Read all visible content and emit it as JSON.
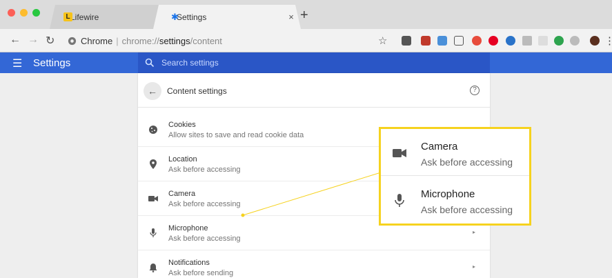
{
  "browser": {
    "tabs": [
      {
        "label": "Lifewire",
        "favicon": "lifewire-logo-icon",
        "favicon_letter": "L",
        "close": "×"
      },
      {
        "label": "Settings",
        "favicon": "gear-icon",
        "close": "×"
      }
    ],
    "new_tab": "+",
    "origin_label": "Chrome",
    "url_scheme": "chrome://",
    "url_host": "settings",
    "url_path": "/content"
  },
  "app": {
    "title": "Settings",
    "search_placeholder": "Search settings",
    "brand_color": "#3367d6"
  },
  "page": {
    "title": "Content settings",
    "help": "?",
    "rows": [
      {
        "title": "Cookies",
        "subtitle": "Allow sites to save and read cookie data",
        "icon": "cookie-icon"
      },
      {
        "title": "Location",
        "subtitle": "Ask before accessing",
        "icon": "location-pin-icon"
      },
      {
        "title": "Camera",
        "subtitle": "Ask before accessing",
        "icon": "camera-icon"
      },
      {
        "title": "Microphone",
        "subtitle": "Ask before accessing",
        "icon": "microphone-icon",
        "arrow": "▸"
      },
      {
        "title": "Notifications",
        "subtitle": "Ask before sending",
        "icon": "bell-icon",
        "arrow": "▸"
      }
    ]
  },
  "callout": {
    "border_color": "#f6d21e",
    "items": [
      {
        "title": "Camera",
        "subtitle": "Ask before accessing",
        "icon": "camera-icon"
      },
      {
        "title": "Microphone",
        "subtitle": "Ask before accessing",
        "icon": "microphone-icon"
      }
    ]
  }
}
